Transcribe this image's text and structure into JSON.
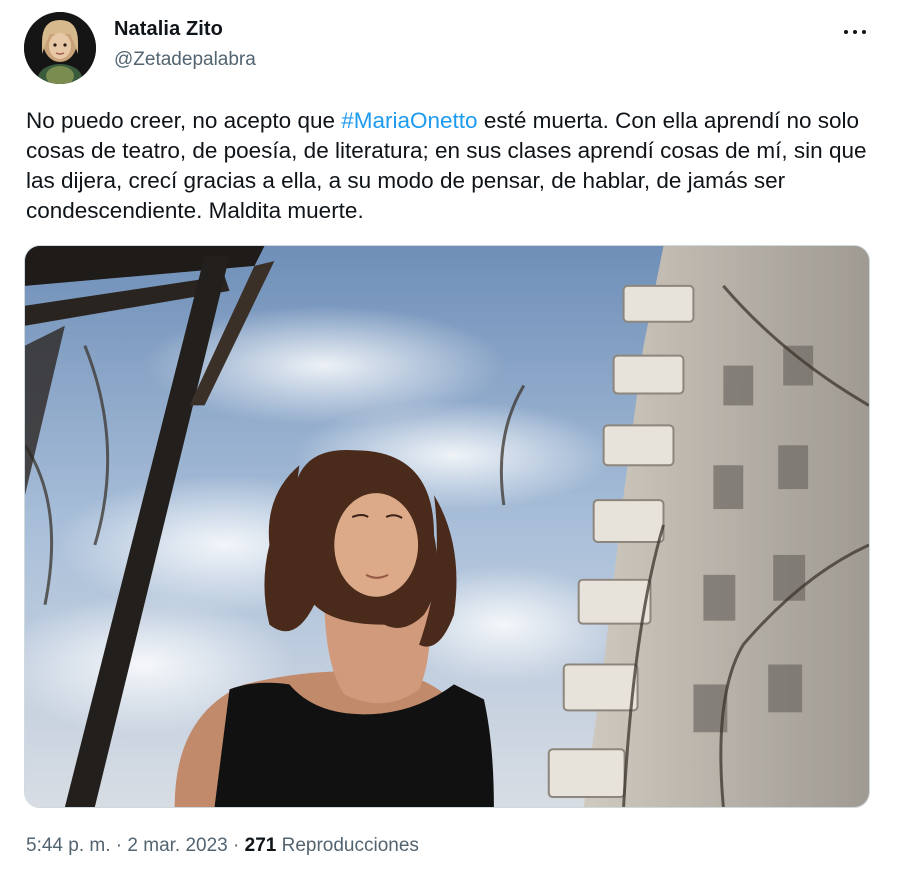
{
  "author": {
    "name": "Natalia Zito",
    "handle": "@Zetadepalabra",
    "avatar_icon": "user-avatar-photo"
  },
  "more_icon": "more-horizontal-icon",
  "tweet": {
    "text_before": "No puedo creer, no acepto que ",
    "hashtag": "#MariaOnetto",
    "text_after": " esté muerta. Con ella aprendí no solo cosas de teatro, de poesía, de literatura; en sus clases aprendí cosas de mí, sin que las dijera, crecí gracias a ella, a su modo de pensar, de hablar, de jamás ser condescendiente. Maldita muerte."
  },
  "media": {
    "icon": "photo-woman-eyes-closed-sky-building"
  },
  "meta": {
    "time": "5:44 p. m.",
    "separator": " · ",
    "date": "2 mar. 2023",
    "views_count": "271",
    "views_label": "Reproducciones"
  },
  "colors": {
    "link": "#1d9bf0",
    "secondary_text": "#536471",
    "primary_text": "#0f1419"
  }
}
